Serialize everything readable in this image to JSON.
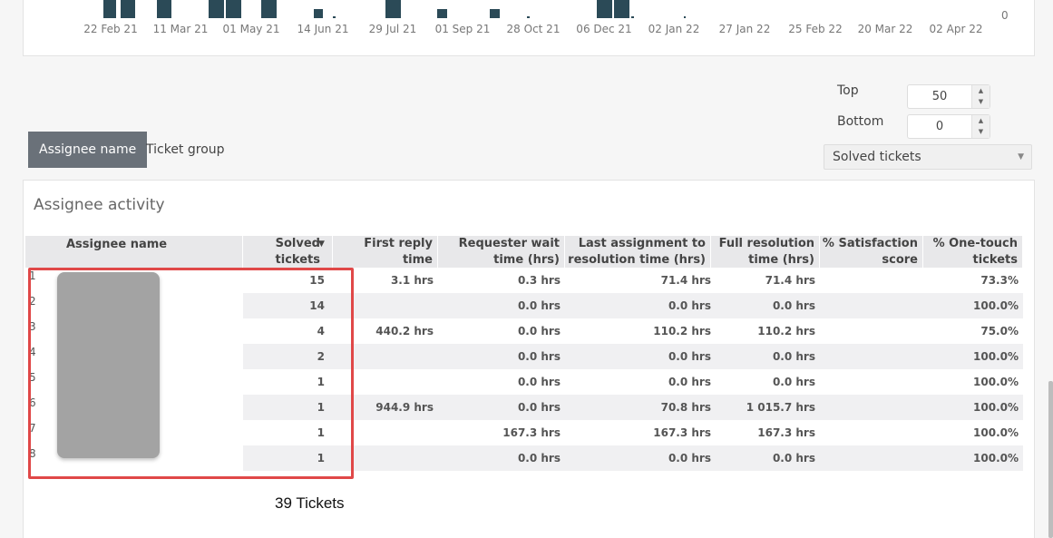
{
  "chart_data": {
    "type": "bar",
    "x_ticks": [
      "22 Feb 21",
      "11 Mar 21",
      "01 May 21",
      "14 Jun 21",
      "29 Jul 21",
      "01 Sep 21",
      "28 Oct 21",
      "06 Dec 21",
      "02 Jan 22",
      "27 Jan 22",
      "25 Feb 22",
      "20 Mar 22",
      "02 Apr 22"
    ],
    "y_zero_label": "0",
    "bar_color": "#2b4a57"
  },
  "tabs": {
    "active": "Assignee name",
    "inactive": "Ticket group"
  },
  "controls": {
    "top_label": "Top",
    "top_value": "50",
    "bottom_label": "Bottom",
    "bottom_value": "0",
    "metric_select": "Solved tickets"
  },
  "table": {
    "title": "Assignee activity",
    "headers": {
      "assignee": "Assignee name",
      "solved": "Solved\ntickets",
      "first_reply": "First reply time\n(hrs)",
      "requester_wait": "Requester wait\ntime (hrs)",
      "last_assignment": "Last assignment to\nresolution time (hrs)",
      "full_resolution": "Full resolution\ntime (hrs)",
      "satisfaction": "% Satisfaction\nscore",
      "one_touch": "% One-touch\ntickets"
    },
    "rows": [
      {
        "n": "1",
        "solved": "15",
        "first_reply": "3.1 hrs",
        "requester_wait": "0.3 hrs",
        "last_assignment": "71.4 hrs",
        "full_resolution": "71.4 hrs",
        "satisfaction": "",
        "one_touch": "73.3%"
      },
      {
        "n": "2",
        "solved": "14",
        "first_reply": "",
        "requester_wait": "0.0 hrs",
        "last_assignment": "0.0 hrs",
        "full_resolution": "0.0 hrs",
        "satisfaction": "",
        "one_touch": "100.0%"
      },
      {
        "n": "3",
        "solved": "4",
        "first_reply": "440.2 hrs",
        "requester_wait": "0.0 hrs",
        "last_assignment": "110.2 hrs",
        "full_resolution": "110.2 hrs",
        "satisfaction": "",
        "one_touch": "75.0%"
      },
      {
        "n": "4",
        "solved": "2",
        "first_reply": "",
        "requester_wait": "0.0 hrs",
        "last_assignment": "0.0 hrs",
        "full_resolution": "0.0 hrs",
        "satisfaction": "",
        "one_touch": "100.0%"
      },
      {
        "n": "5",
        "solved": "1",
        "first_reply": "",
        "requester_wait": "0.0 hrs",
        "last_assignment": "0.0 hrs",
        "full_resolution": "0.0 hrs",
        "satisfaction": "",
        "one_touch": "100.0%"
      },
      {
        "n": "6",
        "solved": "1",
        "first_reply": "944.9 hrs",
        "requester_wait": "0.0 hrs",
        "last_assignment": "70.8 hrs",
        "full_resolution": "1 015.7 hrs",
        "satisfaction": "",
        "one_touch": "100.0%"
      },
      {
        "n": "7",
        "solved": "1",
        "first_reply": "",
        "requester_wait": "167.3 hrs",
        "last_assignment": "167.3 hrs",
        "full_resolution": "167.3 hrs",
        "satisfaction": "",
        "one_touch": "100.0%"
      },
      {
        "n": "8",
        "solved": "1",
        "first_reply": "",
        "requester_wait": "0.0 hrs",
        "last_assignment": "0.0 hrs",
        "full_resolution": "0.0 hrs",
        "satisfaction": "",
        "one_touch": "100.0%"
      }
    ],
    "total_label": "39 Tickets"
  }
}
